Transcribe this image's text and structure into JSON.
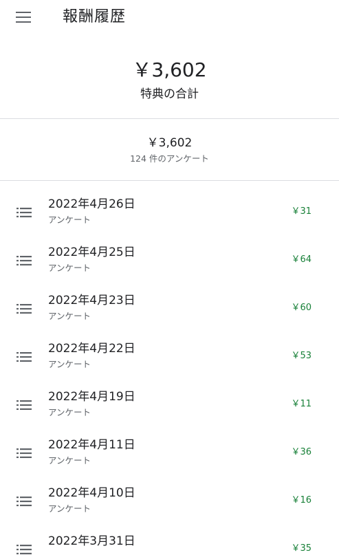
{
  "header": {
    "title": "報酬履歴",
    "menu_icon": "menu-icon"
  },
  "summary": {
    "total_amount": "￥3,602",
    "total_label": "特典の合計",
    "sub_amount": "￥3,602",
    "sub_count": "124 件のアンケート"
  },
  "colors": {
    "reward_amount": "#188038",
    "divider": "#dadce0",
    "secondary_text": "#5f6368"
  },
  "rewards": [
    {
      "date": "2022年4月26日",
      "type": "アンケート",
      "amount": "￥31",
      "icon": "list-icon"
    },
    {
      "date": "2022年4月25日",
      "type": "アンケート",
      "amount": "￥64",
      "icon": "list-icon"
    },
    {
      "date": "2022年4月23日",
      "type": "アンケート",
      "amount": "￥60",
      "icon": "list-icon"
    },
    {
      "date": "2022年4月22日",
      "type": "アンケート",
      "amount": "￥53",
      "icon": "list-icon"
    },
    {
      "date": "2022年4月19日",
      "type": "アンケート",
      "amount": "￥11",
      "icon": "list-icon"
    },
    {
      "date": "2022年4月11日",
      "type": "アンケート",
      "amount": "￥36",
      "icon": "list-icon"
    },
    {
      "date": "2022年4月10日",
      "type": "アンケート",
      "amount": "￥16",
      "icon": "list-icon"
    },
    {
      "date": "2022年3月31日",
      "type": "",
      "amount": "￥35",
      "icon": "list-icon"
    }
  ]
}
